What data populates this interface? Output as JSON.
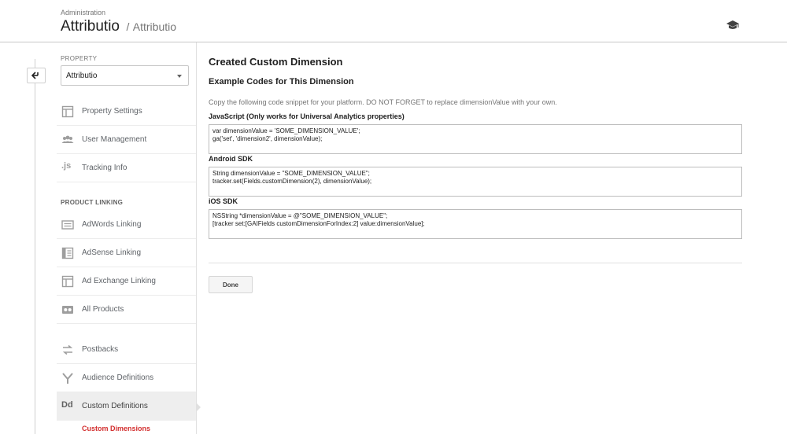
{
  "header": {
    "breadcrumb_top": "Administration",
    "title": "Attributio",
    "separator": "/",
    "subtitle": "Attributio",
    "help_icon": "graduation-cap-icon"
  },
  "rail": {
    "back_icon": "back-arrow-icon"
  },
  "nav": {
    "property_section_label": "PROPERTY",
    "property_selected": "Attributio",
    "items_top": [
      {
        "label": "Property Settings",
        "icon": "window-icon"
      },
      {
        "label": "User Management",
        "icon": "users-icon"
      },
      {
        "label": "Tracking Info",
        "icon": "js-icon",
        "icon_text": ".js"
      }
    ],
    "product_linking_label": "PRODUCT LINKING",
    "items_linking": [
      {
        "label": "AdWords Linking",
        "icon": "adwords-icon"
      },
      {
        "label": "AdSense Linking",
        "icon": "adsense-icon"
      },
      {
        "label": "Ad Exchange Linking",
        "icon": "ad-exchange-icon"
      },
      {
        "label": "All Products",
        "icon": "all-products-icon"
      }
    ],
    "items_bottom": [
      {
        "label": "Postbacks",
        "icon": "postbacks-icon"
      },
      {
        "label": "Audience Definitions",
        "icon": "audience-icon"
      },
      {
        "label": "Custom Definitions",
        "icon": "custom-definitions-icon",
        "icon_text": "Dd"
      }
    ],
    "sub_item": "Custom Dimensions"
  },
  "main": {
    "title": "Created Custom Dimension",
    "subtitle": "Example Codes for This Dimension",
    "description": "Copy the following code snippet for your platform. DO NOT FORGET to replace dimensionValue with your own.",
    "snippets": [
      {
        "label": "JavaScript (Only works for Universal Analytics properties)",
        "lines": [
          "var dimensionValue = 'SOME_DIMENSION_VALUE';",
          "ga('set', 'dimension2', dimensionValue);"
        ]
      },
      {
        "label": "Android SDK",
        "lines": [
          "String dimensionValue = \"SOME_DIMENSION_VALUE\";",
          "tracker.set(Fields.customDimension(2), dimensionValue);"
        ]
      },
      {
        "label": "iOS SDK",
        "lines": [
          "NSString *dimensionValue = @\"SOME_DIMENSION_VALUE\";",
          "[tracker set:[GAIFields customDimensionForIndex:2] value:dimensionValue];"
        ]
      }
    ],
    "done_label": "Done"
  }
}
